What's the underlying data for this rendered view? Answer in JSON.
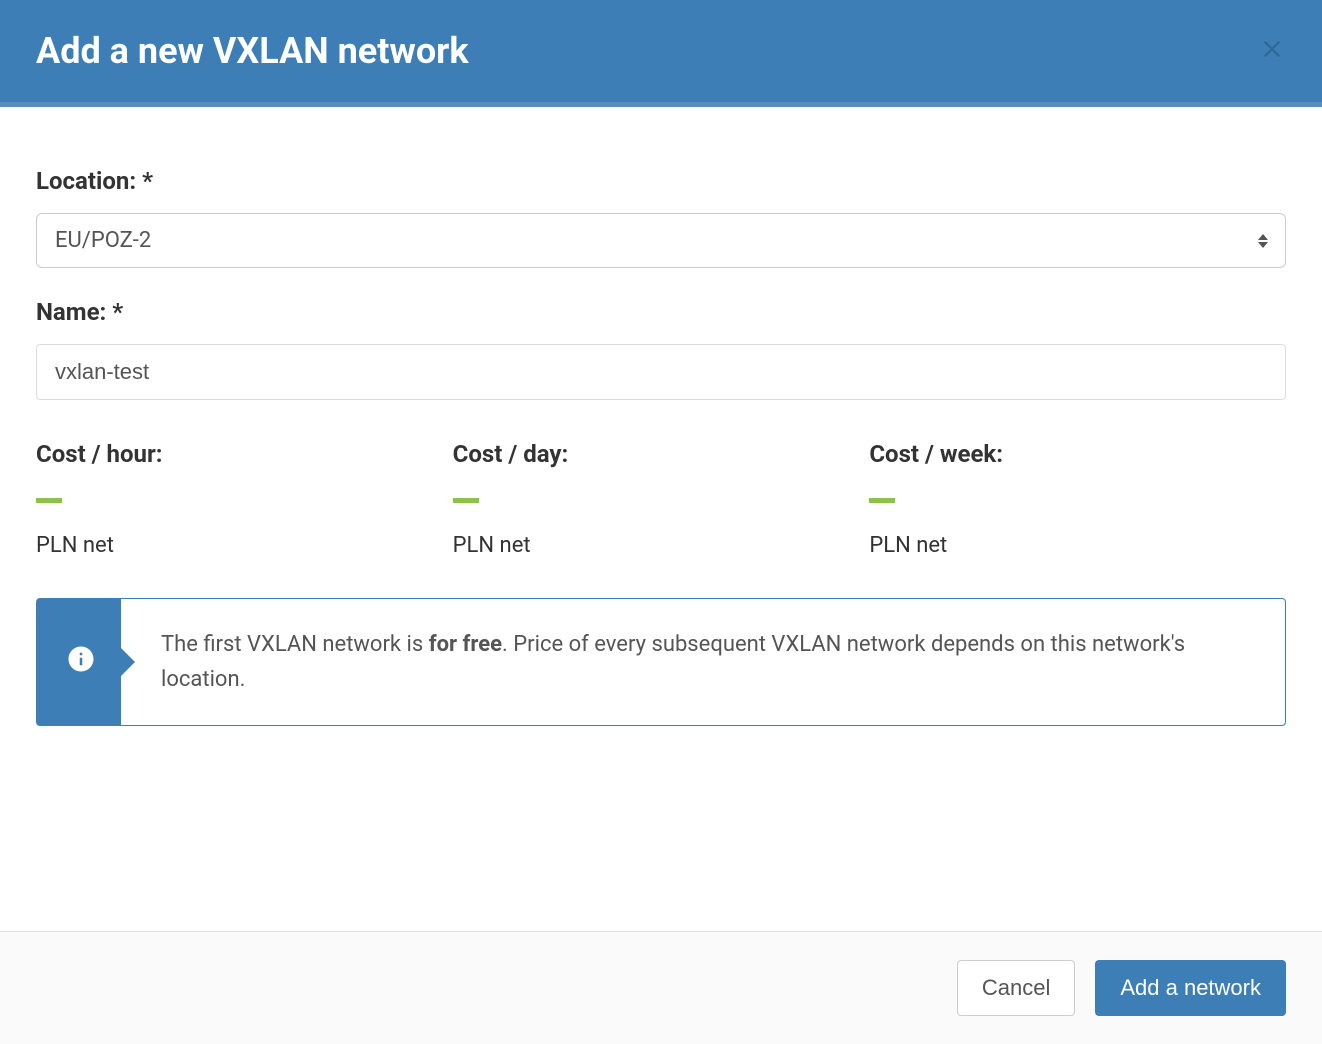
{
  "header": {
    "title": "Add a new VXLAN network"
  },
  "form": {
    "location": {
      "label": "Location: *",
      "value": "EU/POZ-2"
    },
    "name": {
      "label": "Name: *",
      "value": "vxlan-test"
    }
  },
  "costs": {
    "hour": {
      "label": "Cost / hour:",
      "unit": "PLN net"
    },
    "day": {
      "label": "Cost / day:",
      "unit": "PLN net"
    },
    "week": {
      "label": "Cost / week:",
      "unit": "PLN net"
    }
  },
  "info": {
    "text_before": "The first VXLAN network is ",
    "text_bold": "for free",
    "text_after": ". Price of every subsequent VXLAN network depends on this network's location."
  },
  "footer": {
    "cancel_label": "Cancel",
    "submit_label": "Add a network"
  }
}
